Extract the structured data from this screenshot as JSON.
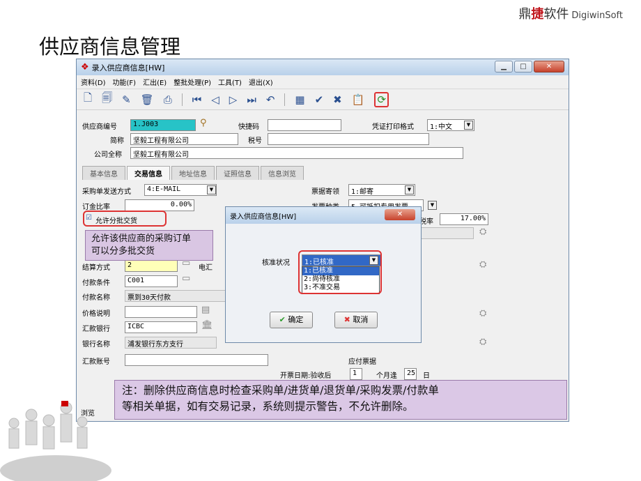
{
  "brand": {
    "cn_prefix": "鼎",
    "cn_jie": "捷",
    "cn_suffix": "软件",
    "en": "DigiwinSoft"
  },
  "slide_title": "供应商信息管理",
  "window": {
    "title": "录入供应商信息[HW]",
    "menu": [
      "资料(D)",
      "功能(F)",
      "汇出(E)",
      "整批处理(P)",
      "工具(T)",
      "退出(X)"
    ]
  },
  "form": {
    "supplier_code_label": "供应商编号",
    "supplier_code": "1.J003",
    "quick_code_label": "快捷码",
    "quick_code": "",
    "voucher_fmt_label": "凭证打印格式",
    "voucher_fmt": "1:中文",
    "short_name_label": "简称",
    "short_name": "坚毅工程有限公司",
    "tax_no_label": "税号",
    "tax_no": "",
    "full_name_label": "公司全称",
    "full_name": "坚毅工程有限公司"
  },
  "tabs": [
    "基本信息",
    "交易信息",
    "地址信息",
    "证照信息",
    "信息浏览"
  ],
  "trade": {
    "po_send_label": "采购单发送方式",
    "po_send": "4:E-MAIL",
    "invoice_recv_label": "票据寄领",
    "invoice_recv": "1:邮寄",
    "deposit_label": "订金比率",
    "deposit": "0.00%",
    "invoice_type_label": "发票种类",
    "invoice_type": "5.可抵扣专用发票",
    "allow_batch_label": "允许分批交货",
    "tax_rate_label": "税率",
    "tax_rate": "17.00%",
    "settle_label": "结算方式",
    "settle": "2",
    "settle_suffix": "电汇",
    "pay_term_label": "付款条件",
    "pay_term": "C001",
    "pay_name_label": "付款名称",
    "pay_name": "票到30天付款",
    "price_note_label": "价格说明",
    "price_note": "",
    "bank_label": "汇款银行",
    "bank": "ICBC",
    "bank_name_label": "银行名称",
    "bank_name": "浦发银行东方支行",
    "account_label": "汇款账号",
    "account": "",
    "payable_label": "应付票据",
    "issue_label": "开票日期:验收后",
    "issue_months": "1",
    "issue_mid": "个月逢",
    "issue_day": "25",
    "issue_unit": "日",
    "browse_label": "浏览"
  },
  "callout_batch": [
    "允许该供应商的采购订单",
    "可以分多批交货"
  ],
  "dialog": {
    "title": "录入供应商信息[HW]",
    "status_label": "核准状况",
    "status_value": "1:已核准",
    "options": [
      "1:已核准",
      "2:尚待核准",
      "3:不准交易"
    ],
    "ok": "确定",
    "cancel": "取消"
  },
  "note": [
    "注：删除供应商信息时检查采购单/进货单/退货单/采购发票/付款单",
    "等相关单据，如有交易记录，系统则提示警告，不允许删除。"
  ]
}
